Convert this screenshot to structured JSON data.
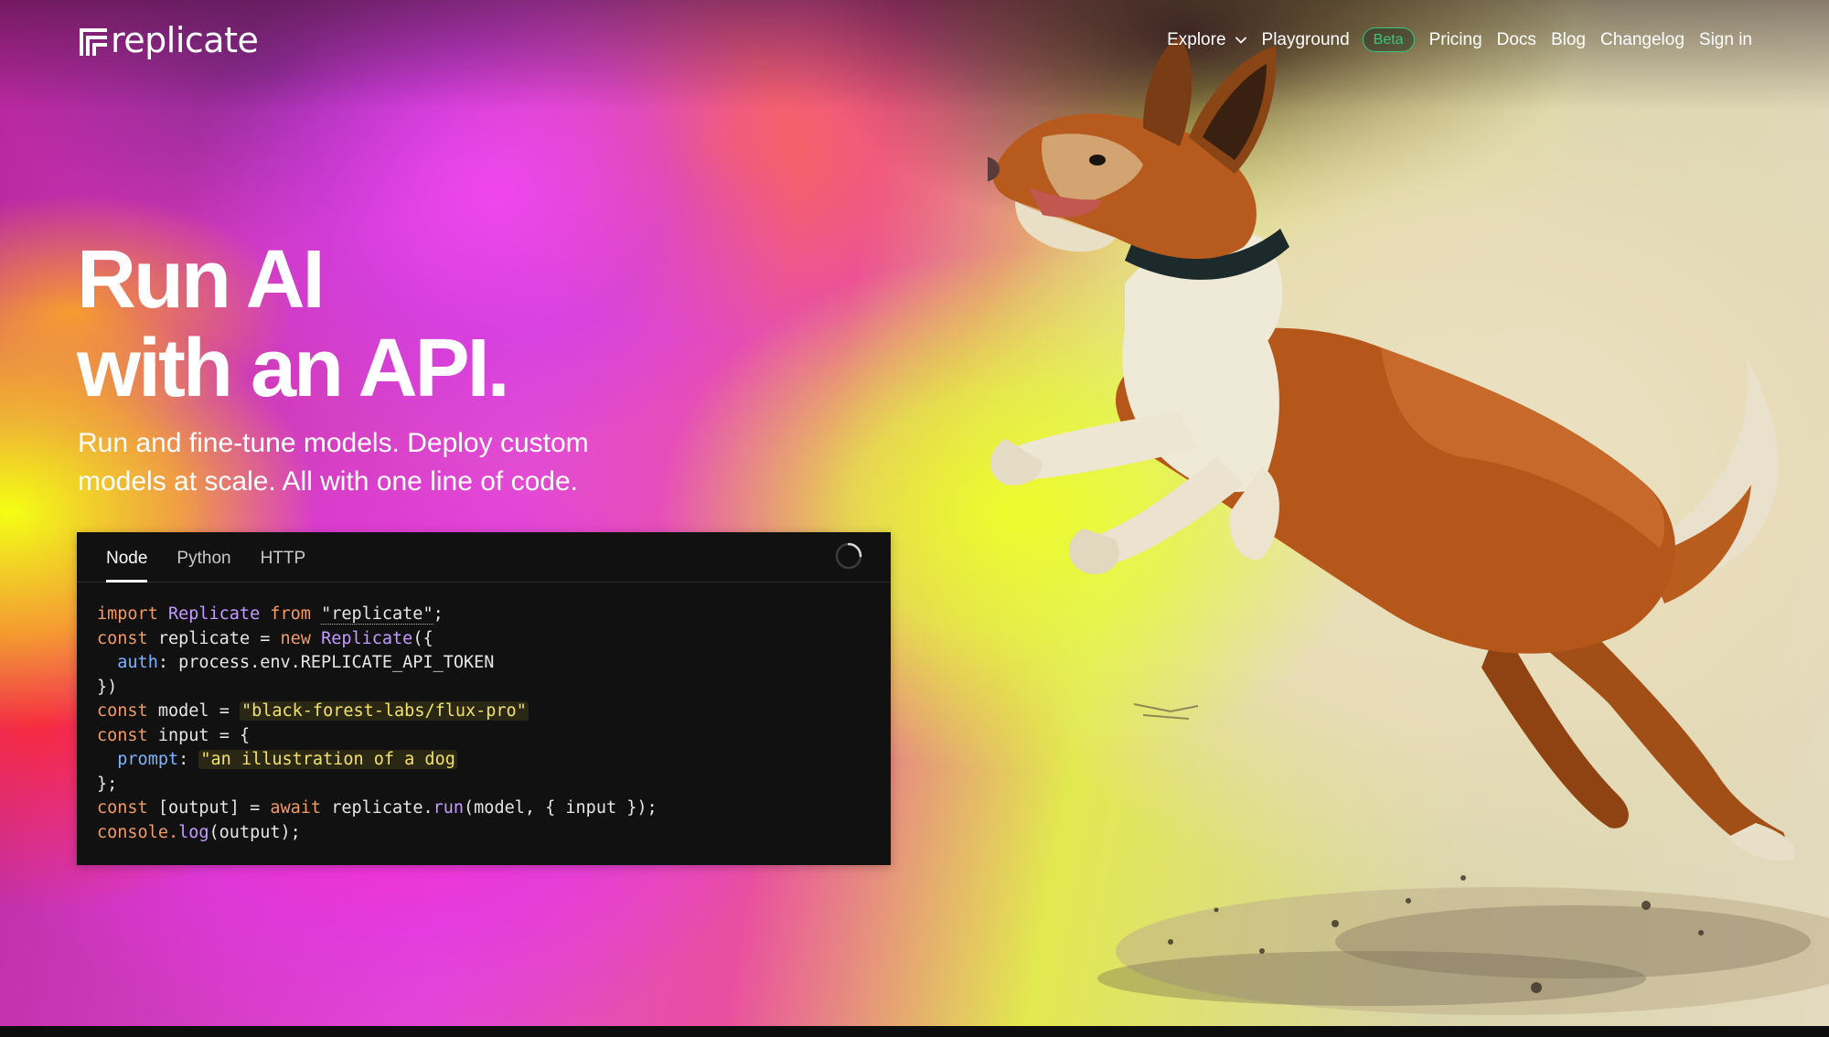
{
  "brand": {
    "logo_text": "replicate"
  },
  "nav": {
    "explore": "Explore",
    "playground": "Playground",
    "beta_badge": "Beta",
    "pricing": "Pricing",
    "docs": "Docs",
    "blog": "Blog",
    "changelog": "Changelog",
    "sign_in": "Sign in"
  },
  "hero": {
    "title_line1": "Run AI",
    "title_line2": "with an API.",
    "subtitle": "Run and fine-tune models. Deploy custom models at scale. All with one line of code."
  },
  "code": {
    "tabs": [
      "Node",
      "Python",
      "HTTP"
    ],
    "active_tab": "Node",
    "line1": {
      "kw_import": "import",
      "cls_replicate": "Replicate",
      "kw_from": "from",
      "module": "\"replicate\"",
      "semi": ";"
    },
    "line2": {
      "kw_const": "const",
      "var": "replicate",
      "eq": "=",
      "kw_new": "new",
      "cls": "Replicate",
      "open": "({"
    },
    "line3": {
      "prop": "auth",
      "value": "process.env.REPLICATE_API_TOKEN"
    },
    "line4": {
      "text": "})"
    },
    "line5": {
      "kw_const": "const",
      "var": "model",
      "eq": "=",
      "model_value": "\"black-forest-labs/flux-pro\""
    },
    "line6": {
      "kw_const": "const",
      "var": "input",
      "eq": "=",
      "open": "{"
    },
    "line7": {
      "prop": "prompt",
      "prompt_value": "\"an illustration of a dog"
    },
    "line8": {
      "text": "};"
    },
    "line9": {
      "kw_const": "const",
      "destructure": "[output]",
      "eq": "=",
      "kw_await": "await",
      "obj": "replicate.",
      "fn_run": "run",
      "args": "(model, { input });"
    },
    "line10": {
      "obj": "console.",
      "fn_log": "log",
      "args": "(output);"
    }
  },
  "icons": {
    "logo_mark": "replicate-logo-icon",
    "explore_chevron": "chevron-down-icon",
    "spinner": "loading-spinner-icon"
  },
  "colors": {
    "beta": "#37c87e",
    "code_bg": "#111112",
    "keyword": "#f19a66",
    "class": "#c49bff",
    "property": "#7cb3ff",
    "string": "#f2e26b"
  }
}
